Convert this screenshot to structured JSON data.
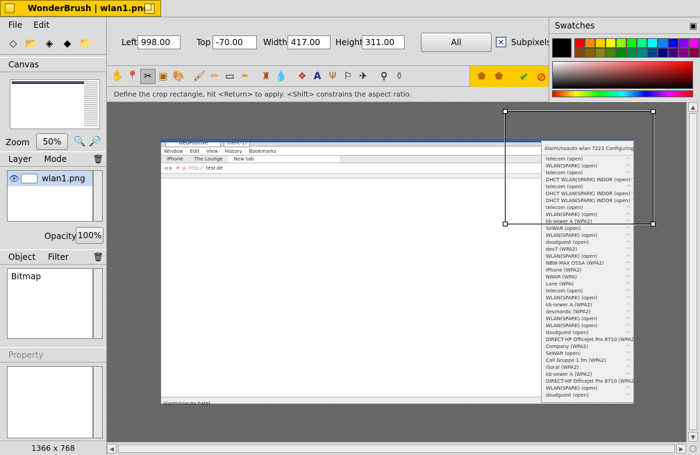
{
  "window": {
    "title": "WonderBrush | wlan1.png"
  },
  "menu": {
    "items": [
      "File",
      "Edit"
    ]
  },
  "canvas_panel": {
    "header": "Canvas",
    "zoom_label": "Zoom",
    "zoom_value": "50%"
  },
  "layer_panel": {
    "header_layer": "Layer",
    "header_mode": "Mode",
    "layer_name": "wlan1.png",
    "opacity_label": "Opacity",
    "opacity_value": "100%"
  },
  "object_panel": {
    "header_object": "Object",
    "header_filter": "Filter",
    "item": "Bitmap"
  },
  "property_panel": {
    "header": "Property"
  },
  "status": {
    "dimensions": "1366 x 768"
  },
  "crop": {
    "left_label": "Left",
    "left_value": "998.00",
    "top_label": "Top",
    "top_value": "-70.00",
    "width_label": "Width",
    "width_value": "417.00",
    "height_label": "Height",
    "height_value": "311.00",
    "all_label": "All",
    "subpixels_label": "Subpixels",
    "subpixels_checked": true
  },
  "hint": "Define the crop rectangle, hit <Return> to apply. <Shift> constrains the aspect ratio.",
  "swatches": {
    "header": "Swatches",
    "current": "#000000",
    "row1": [
      "#ff0000",
      "#ff8800",
      "#ffcc00",
      "#ffff00",
      "#88ff00",
      "#00ff00",
      "#00ff88",
      "#00ffff",
      "#0088ff",
      "#0000ff",
      "#8800ff",
      "#ff00ff",
      "#ff0088"
    ],
    "row2": [
      "#884400",
      "#886600",
      "#888800",
      "#448800",
      "#008800",
      "#008844",
      "#008888",
      "#004488",
      "#000088",
      "#440088",
      "#880088",
      "#880044",
      "#440000"
    ]
  },
  "tools": [
    "hand-icon",
    "pin-icon",
    "crop-icon",
    "box-icon",
    "palette-icon",
    "brush-icon",
    "pencil-icon",
    "eraser-icon",
    "pen-icon",
    "stamp-icon",
    "drop-icon",
    "blur-icon",
    "text-icon",
    "path-icon",
    "shape-icon",
    "select-icon",
    "picker-icon",
    "bucket-icon",
    "undo-icon",
    "redo-icon",
    "confirm-icon",
    "cancel-icon"
  ],
  "screenshot_content": {
    "tab1": "WebPositive",
    "tab2": "ment-1)",
    "menus": [
      "Window",
      "Edit",
      "View",
      "History",
      "Bookmarks"
    ],
    "page_tabs": [
      "iPhone",
      "The Lounge",
      "New tab"
    ],
    "url_prefix": "http://",
    "url": "test.de",
    "status_bar": "Alarm/noauto hatel",
    "dropdown_header": "Alarm/noauto wlan 7223 Configuring",
    "networks": [
      "telecom (open)",
      "WLAN(SPARK) (open)",
      "telecom (open)",
      "DHCT WLAN(SPARK) INDOR (open)",
      "telecom (open)",
      "DHCT WLAN(SPARK) INDOR (open)",
      "DHCT WLAN(SPARK) INDOR (open)",
      "telecom (open)",
      "WLAN(SPARK) (open)",
      "kb-sewer A (WPA2)",
      "SeWAR (open)",
      "WLAN(SPARK) (open)",
      "dsudguest (open)",
      "dev7 (WPA2)",
      "WLAN(SPARK) (open)",
      "NBW-MAX OSSA (WPA2)",
      "iPhone (WPA2)",
      "NWAR (WPA)",
      "Lane (WPA)",
      "telecom (open)",
      "WLAN(SPARK) (open)",
      "kb-sewer A (WPA2)",
      "dev/nordic (WPA2)",
      "WLAN(SPARK) (open)",
      "WLAN(SPARK) (open)",
      "dsudguest (open)",
      "DIRECT-HP OfficeJet Pro 8710 (WPA2)",
      "Company (WPA2)",
      "SeWAR (open)",
      "Call Gruppe 1 fm (WPA2)",
      "iSoral (WPA2)",
      "kb-sewer A (WPA2)",
      "DIRECT-HP OfficeJet Pro 8710 (WPA2)",
      "WLAN(SPARK) (open)",
      "dsudguest (open)"
    ]
  }
}
